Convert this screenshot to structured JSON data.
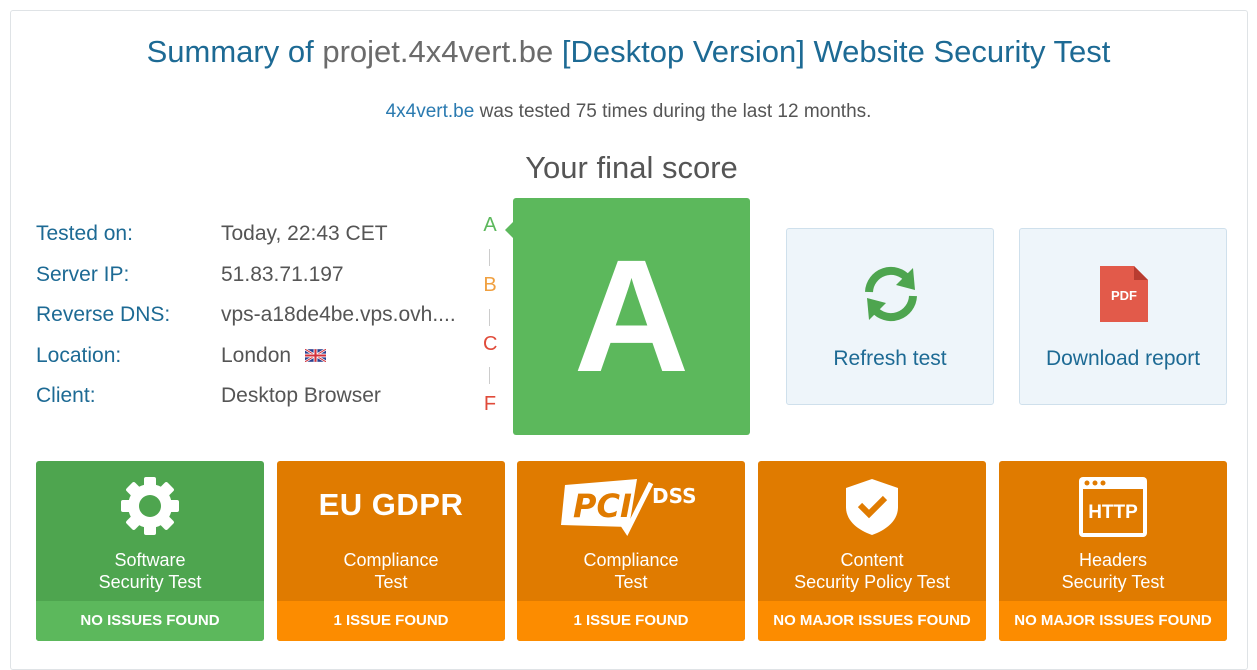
{
  "header": {
    "title_prefix": "Summary of",
    "domain": "projet.4x4vert.be",
    "title_suffix": "[Desktop Version] Website Security Test",
    "subtitle_link": "4x4vert.be",
    "subtitle_text": "was tested 75 times during the last 12 months."
  },
  "score": {
    "heading": "Your final score",
    "grade": "A",
    "scale": [
      "A",
      "B",
      "C",
      "F"
    ]
  },
  "info": {
    "tested_on_label": "Tested on:",
    "tested_on_value": "Today, 22:43 CET",
    "server_ip_label": "Server IP:",
    "server_ip_value": "51.83.71.197",
    "reverse_dns_label": "Reverse DNS:",
    "reverse_dns_value": "vps-a18de4be.vps.ovh....",
    "location_label": "Location:",
    "location_value": "London",
    "client_label": "Client:",
    "client_value": "Desktop Browser"
  },
  "actions": {
    "refresh_label": "Refresh test",
    "download_label": "Download report",
    "pdf_icon_text": "PDF"
  },
  "tests": [
    {
      "line1": "Software",
      "line2": "Security Test",
      "status": "NO ISSUES FOUND",
      "icon": "gear-icon"
    },
    {
      "line1": "Compliance",
      "line2": "Test",
      "status": "1 ISSUE FOUND",
      "icon_text": "EU GDPR"
    },
    {
      "line1": "Compliance",
      "line2": "Test",
      "status": "1 ISSUE FOUND",
      "icon_text": "PCI DSS"
    },
    {
      "line1": "Content",
      "line2": "Security Policy Test",
      "status": "NO MAJOR ISSUES FOUND",
      "icon": "shield-check-icon"
    },
    {
      "line1": "Headers",
      "line2": "Security Test",
      "status": "NO MAJOR ISSUES FOUND",
      "icon": "http-window-icon",
      "icon_text": "HTTP"
    }
  ],
  "colors": {
    "title_blue": "#1d6a94",
    "grade_green": "#5cb85c",
    "issue_orange": "#e07b00",
    "grade_b": "#f0a040",
    "grade_c": "#e04b3a",
    "grade_f": "#e04b3a"
  }
}
